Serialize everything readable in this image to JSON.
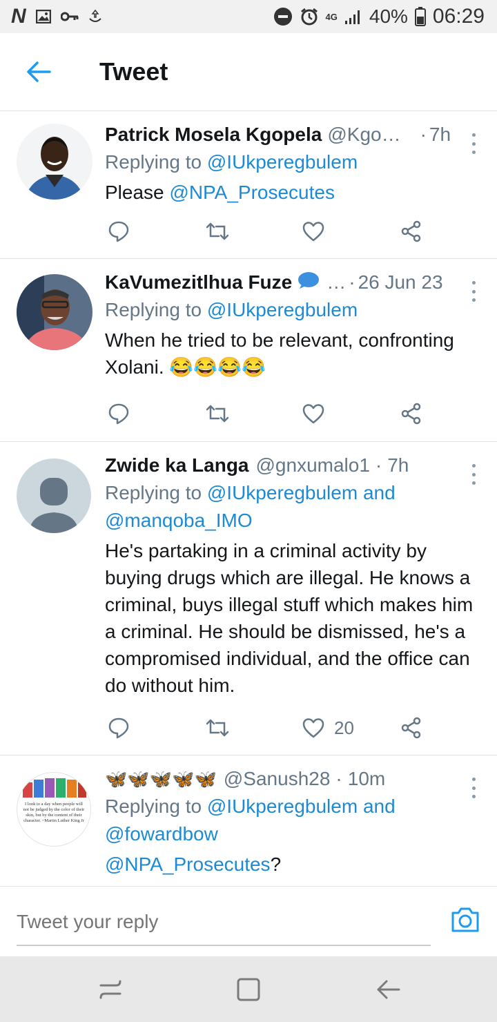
{
  "status_bar": {
    "battery": "40%",
    "time": "06:29",
    "network": "4G"
  },
  "header": {
    "title": "Tweet"
  },
  "tweets": [
    {
      "name": "Patrick Mosela Kgopela",
      "handle": "@Kgo…",
      "time": "7h",
      "reply_prefix": "Replying to ",
      "reply_handles": "@IUkperegbulem",
      "text_prefix": "Please ",
      "text_link": "@NPA_Prosecutes",
      "likes": ""
    },
    {
      "name": "KaVumezitlhua Fuze",
      "handle": "…",
      "time": "26 Jun 23",
      "reply_prefix": "Replying to ",
      "reply_handles": "@IUkperegbulem",
      "text": "When he tried to be relevant, confronting Xolani. 😂😂😂😂",
      "likes": ""
    },
    {
      "name": "Zwide ka Langa",
      "handle": "@gnxumalo1",
      "time": "7h",
      "reply_prefix": "Replying to ",
      "reply_handles": "@IUkperegbulem and @manqoba_IMO",
      "text": "He's partaking in a criminal activity by buying drugs which are illegal. He knows a criminal, buys illegal stuff which makes him a criminal. He should be dismissed, he's a compromised individual, and the office can do without him.",
      "likes": "20"
    },
    {
      "name": "🦋🦋🦋🦋🦋",
      "handle": "@Sanush28",
      "time": "10m",
      "reply_prefix": "Replying to ",
      "reply_handles": "@IUkperegbulem and @fowardbow",
      "text_link": "@NPA_Prosecutes",
      "text_suffix": "?",
      "avatar_quote": "I look to a day when people will not be judged by the color of their skin, but by the content of their character. ~Martin Luther King Jr"
    }
  ],
  "composer": {
    "placeholder": "Tweet your reply"
  },
  "icons": {
    "back": "back-arrow-icon",
    "reply": "reply-icon",
    "retweet": "retweet-icon",
    "like": "heart-icon",
    "share": "share-icon",
    "more": "more-vertical-icon",
    "camera": "camera-icon",
    "verified": "speech-bubble-emoji"
  },
  "colors": {
    "accent": "#1d9bf0",
    "link": "#1d8ad6",
    "secondary": "#657786"
  }
}
